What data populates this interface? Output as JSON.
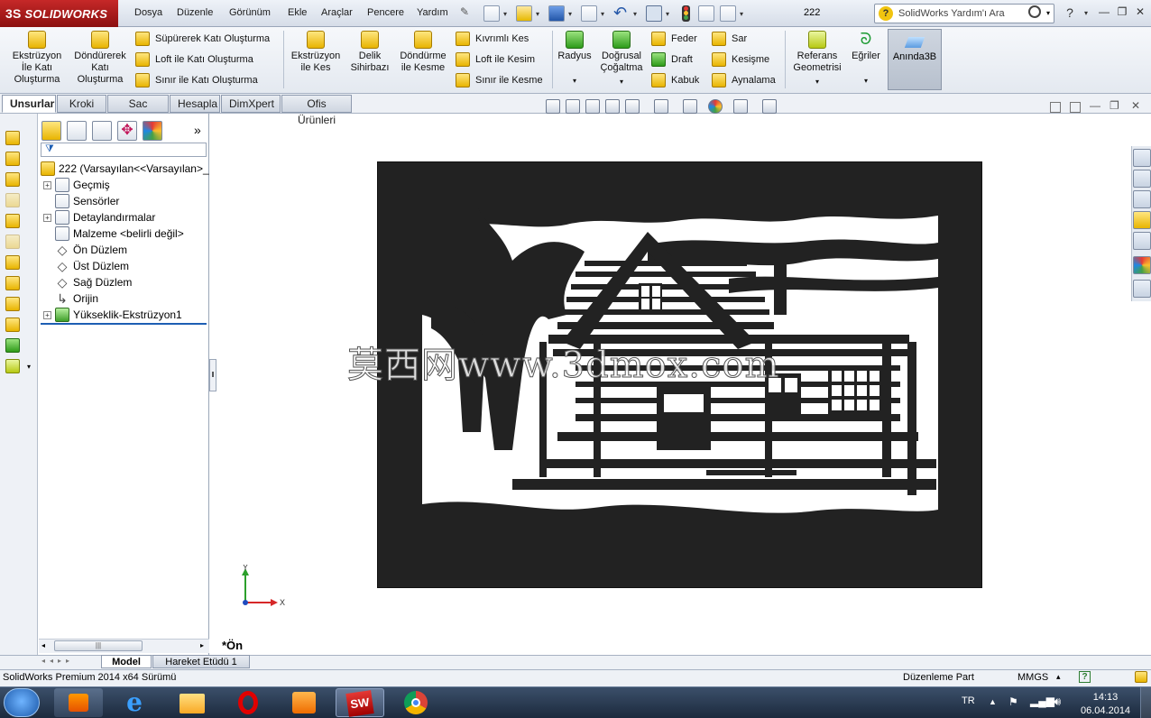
{
  "app": {
    "name": "SOLIDWORKS",
    "logo_prefix": "3S"
  },
  "menu": [
    "Dosya",
    "Düzenle",
    "Görünüm",
    "Ekle",
    "Araçlar",
    "Pencere",
    "Yardım"
  ],
  "document_title": "222",
  "help_search": {
    "placeholder": "SolidWorks Yardım'ı Ara",
    "help_glyph": "?"
  },
  "window_controls": {
    "help": "?",
    "help_caret": "▾",
    "minimize": "—",
    "restore": "❐",
    "close": "✕"
  },
  "command_manager": {
    "group1": [
      {
        "label": "Ekstrüzyon\nİle Katı\nOluşturma"
      },
      {
        "label": "Döndürerek\nKatı\nOluşturma"
      }
    ],
    "group1_small": [
      "Süpürerek Katı Oluşturma",
      "Loft ile Katı Oluşturma",
      "Sınır ile Katı Oluşturma"
    ],
    "group2": [
      {
        "label": "Ekstrüzyon\nile Kes"
      },
      {
        "label": "Delik\nSihirbazı"
      },
      {
        "label": "Döndürme\nile Kesme"
      }
    ],
    "group2_small": [
      "Kıvrımlı Kes",
      "Loft ile Kesim",
      "Sınır ile Kesme"
    ],
    "group3": [
      {
        "label": "Radyus"
      },
      {
        "label": "Doğrusal\nÇoğaltma"
      }
    ],
    "group3_small_a": [
      "Feder",
      "Draft",
      "Kabuk"
    ],
    "group3_small_b": [
      "Sar",
      "Kesişme",
      "Aynalama"
    ],
    "group4": [
      {
        "label": "Referans\nGeometrisi"
      },
      {
        "label": "Eğriler"
      }
    ],
    "instant3d": "Anında3B"
  },
  "tabs": [
    "Unsurlar",
    "Kroki",
    "Sac Levha",
    "Hesapla",
    "DimXpert",
    "Ofis Ürünleri"
  ],
  "active_tab": "Unsurlar",
  "feature_tree": {
    "root": "222  (Varsayılan<<Varsayılan>_",
    "items": [
      {
        "label": "Geçmiş",
        "expandable": true,
        "icon": "history-icon"
      },
      {
        "label": "Sensörler",
        "expandable": false,
        "icon": "sensor-icon"
      },
      {
        "label": "Detaylandırmalar",
        "expandable": true,
        "icon": "annotation-icon"
      },
      {
        "label": "Malzeme <belirli değil>",
        "expandable": false,
        "icon": "material-icon"
      },
      {
        "label": "Ön Düzlem",
        "expandable": false,
        "icon": "plane-icon"
      },
      {
        "label": "Üst Düzlem",
        "expandable": false,
        "icon": "plane-icon"
      },
      {
        "label": "Sağ Düzlem",
        "expandable": false,
        "icon": "plane-icon"
      },
      {
        "label": "Orijin",
        "expandable": false,
        "icon": "origin-icon"
      },
      {
        "label": "Yükseklik-Ekstrüzyon1",
        "expandable": true,
        "icon": "extrude-icon"
      }
    ]
  },
  "fm_collapse_glyph": "»",
  "fm_scroll_grip": "|||",
  "bottom_tabs": [
    "Model",
    "Hareket Etüdü 1"
  ],
  "status": {
    "left": "SolidWorks Premium 2014 x64 Sürümü",
    "mode": "Düzenleme Part",
    "units": "MMGS",
    "units_caret": "▴",
    "help_glyph": "?"
  },
  "view": {
    "orientation": "*Ön",
    "triad_y": "Y",
    "triad_x": "X"
  },
  "watermark": "莫西网www.3dmox.com",
  "taskbar": {
    "apps": [
      "start-button",
      "media-player",
      "internet-explorer",
      "file-explorer",
      "opera",
      "outlook",
      "solidworks",
      "chrome"
    ],
    "language": "TR",
    "time": "14:13",
    "date": "06.04.2014"
  }
}
